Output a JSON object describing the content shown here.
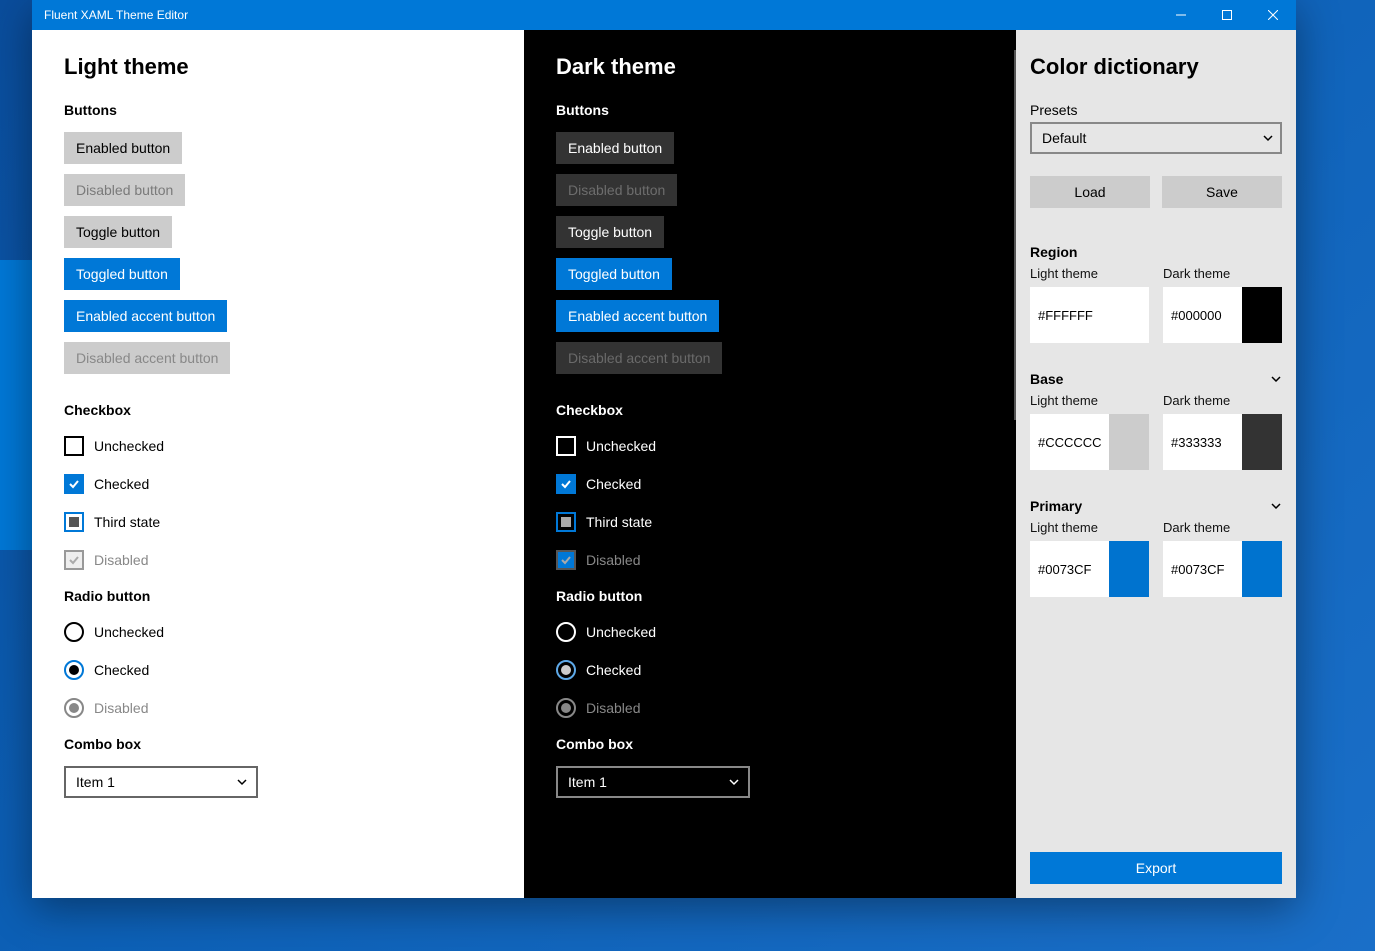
{
  "window": {
    "title": "Fluent XAML Theme Editor"
  },
  "panels": {
    "light": {
      "title": "Light theme"
    },
    "dark": {
      "title": "Dark theme"
    }
  },
  "sections": {
    "buttons": "Buttons",
    "checkbox": "Checkbox",
    "radio": "Radio button",
    "combo": "Combo box"
  },
  "buttons": {
    "enabled": "Enabled button",
    "disabled": "Disabled button",
    "toggle": "Toggle button",
    "toggled": "Toggled button",
    "accent_enabled": "Enabled accent button",
    "accent_disabled": "Disabled accent button"
  },
  "checkbox": {
    "unchecked": "Unchecked",
    "checked": "Checked",
    "third": "Third state",
    "disabled": "Disabled"
  },
  "radio": {
    "unchecked": "Unchecked",
    "checked": "Checked",
    "disabled": "Disabled"
  },
  "combo": {
    "item": "Item 1"
  },
  "sidebar": {
    "title": "Color dictionary",
    "presets_label": "Presets",
    "preset_value": "Default",
    "load": "Load",
    "save": "Save",
    "light_label": "Light theme",
    "dark_label": "Dark theme",
    "export": "Export",
    "region": {
      "title": "Region",
      "light_hex": "#FFFFFF",
      "light_chip": "#FFFFFF",
      "dark_hex": "#000000",
      "dark_chip": "#000000"
    },
    "base": {
      "title": "Base",
      "light_hex": "#CCCCCC",
      "light_chip": "#CCCCCC",
      "dark_hex": "#333333",
      "dark_chip": "#333333"
    },
    "primary": {
      "title": "Primary",
      "light_hex": "#0073CF",
      "light_chip": "#0073CF",
      "dark_hex": "#0073CF",
      "dark_chip": "#0073CF"
    }
  }
}
